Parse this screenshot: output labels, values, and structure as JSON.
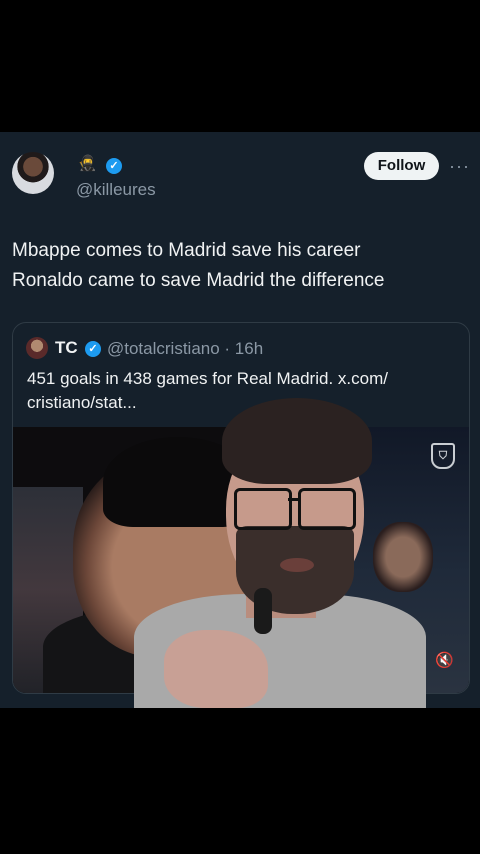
{
  "tweet": {
    "name_emoji": "🥷",
    "handle": "@killeures",
    "follow_label": "Follow",
    "more_label": "···",
    "text_lines": [
      "Mbappe comes to Madrid save his career",
      "Ronaldo came to save Madrid the difference"
    ]
  },
  "quote": {
    "name": "TC",
    "handle_time": "@totalcristiano · 16h",
    "text_lines": [
      "451 goals in 438 games for Real Madrid. x.com/",
      "cristiano/stat..."
    ]
  },
  "colors": {
    "background": "#000000",
    "tweet_bg": "#15202b",
    "verified": "#1d9bf0",
    "muted_text": "#8b98a5"
  },
  "icons": {
    "verified": "verified-badge-icon",
    "more": "more-icon",
    "mute": "mute-icon",
    "brand": "brand-logo-icon"
  }
}
